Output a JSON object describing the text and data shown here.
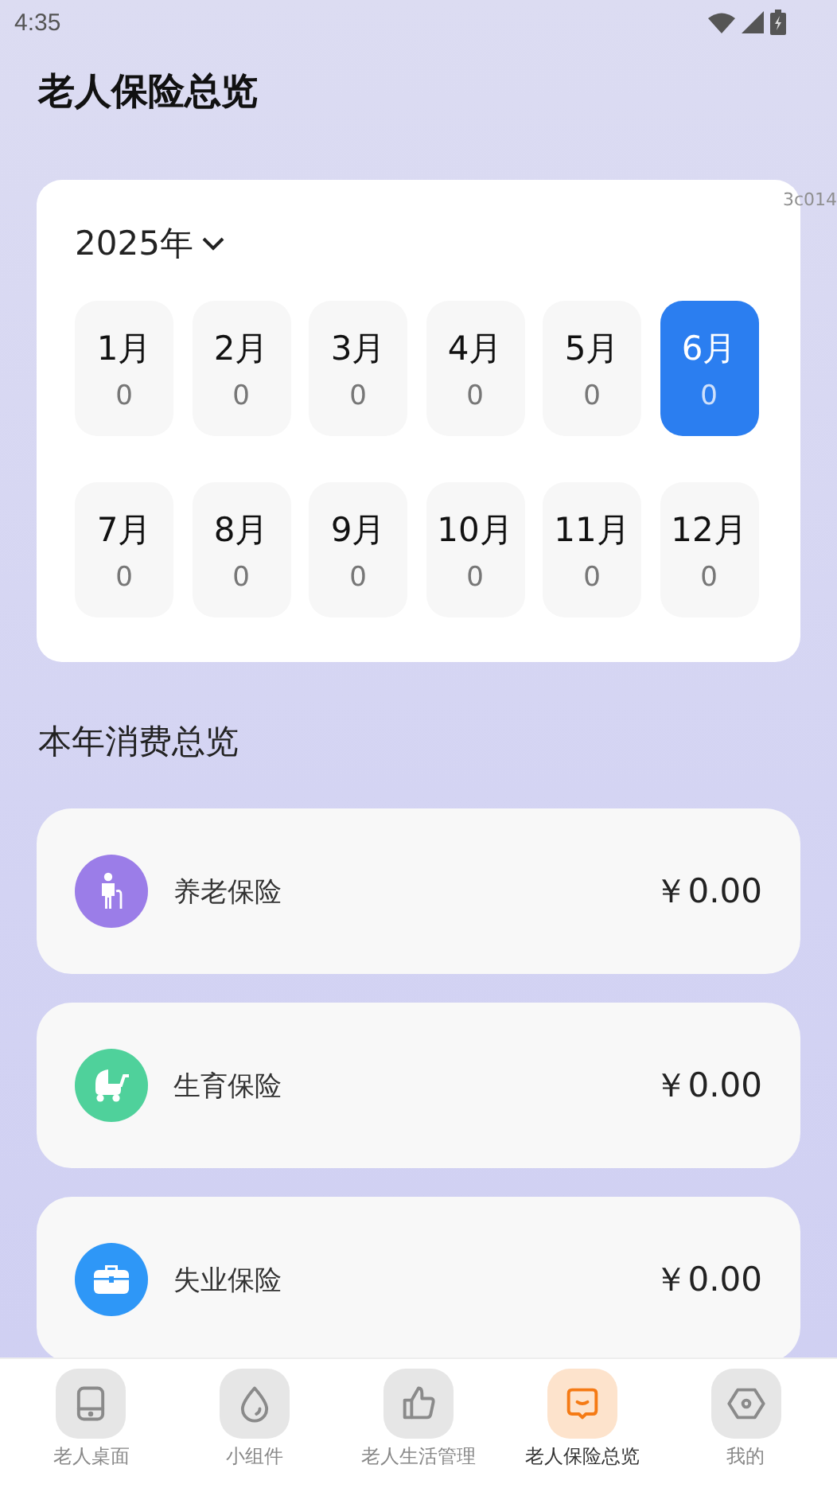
{
  "status_bar": {
    "time": "4:35"
  },
  "title": "老人保险总览",
  "debug_label": "3c014",
  "calendar": {
    "year": "2025年",
    "months": [
      {
        "label": "1月",
        "count": "0",
        "selected": false
      },
      {
        "label": "2月",
        "count": "0",
        "selected": false
      },
      {
        "label": "3月",
        "count": "0",
        "selected": false
      },
      {
        "label": "4月",
        "count": "0",
        "selected": false
      },
      {
        "label": "5月",
        "count": "0",
        "selected": false
      },
      {
        "label": "6月",
        "count": "0",
        "selected": true
      },
      {
        "label": "7月",
        "count": "0",
        "selected": false
      },
      {
        "label": "8月",
        "count": "0",
        "selected": false
      },
      {
        "label": "9月",
        "count": "0",
        "selected": false
      },
      {
        "label": "10月",
        "count": "0",
        "selected": false
      },
      {
        "label": "11月",
        "count": "0",
        "selected": false
      },
      {
        "label": "12月",
        "count": "0",
        "selected": false
      }
    ]
  },
  "section_title": "本年消费总览",
  "insurances": [
    {
      "kind": "pension",
      "name": "养老保险",
      "amount": "￥0.00",
      "color": "#9b7de8"
    },
    {
      "kind": "maternity",
      "name": "生育保险",
      "amount": "￥0.00",
      "color": "#4fd19b"
    },
    {
      "kind": "unemployment",
      "name": "失业保险",
      "amount": "￥0.00",
      "color": "#2e97f7"
    }
  ],
  "nav": [
    {
      "kind": "tablet",
      "label": "老人桌面",
      "selected": false
    },
    {
      "kind": "drop",
      "label": "小组件",
      "selected": false
    },
    {
      "kind": "thumb",
      "label": "老人生活管理",
      "selected": false
    },
    {
      "kind": "chat",
      "label": "老人保险总览",
      "selected": true
    },
    {
      "kind": "hex",
      "label": "我的",
      "selected": false
    }
  ]
}
